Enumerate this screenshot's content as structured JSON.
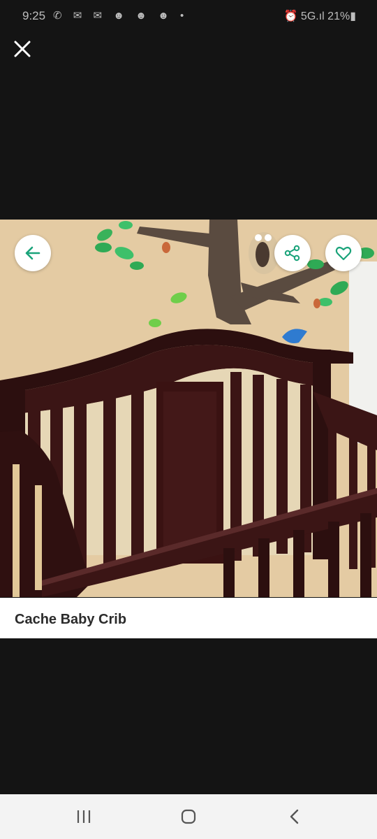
{
  "status_bar": {
    "time": "9:25",
    "notification_icons": "✆ ✉ ✉ ☻ ☻ ☻ •",
    "right_text": "⏰ 5G.ıl 21%▮"
  },
  "listing": {
    "title": "Cache Baby Crib"
  },
  "icons": {
    "close": "close-icon",
    "back": "arrow-left-icon",
    "share": "share-icon",
    "favorite": "heart-icon",
    "recents": "recents-icon",
    "home": "home-icon",
    "nav_back": "chevron-left-icon"
  },
  "colors": {
    "accent": "#1aa37a",
    "background": "#141414",
    "crib": "#3b1515",
    "wall": "#e4cba3"
  }
}
